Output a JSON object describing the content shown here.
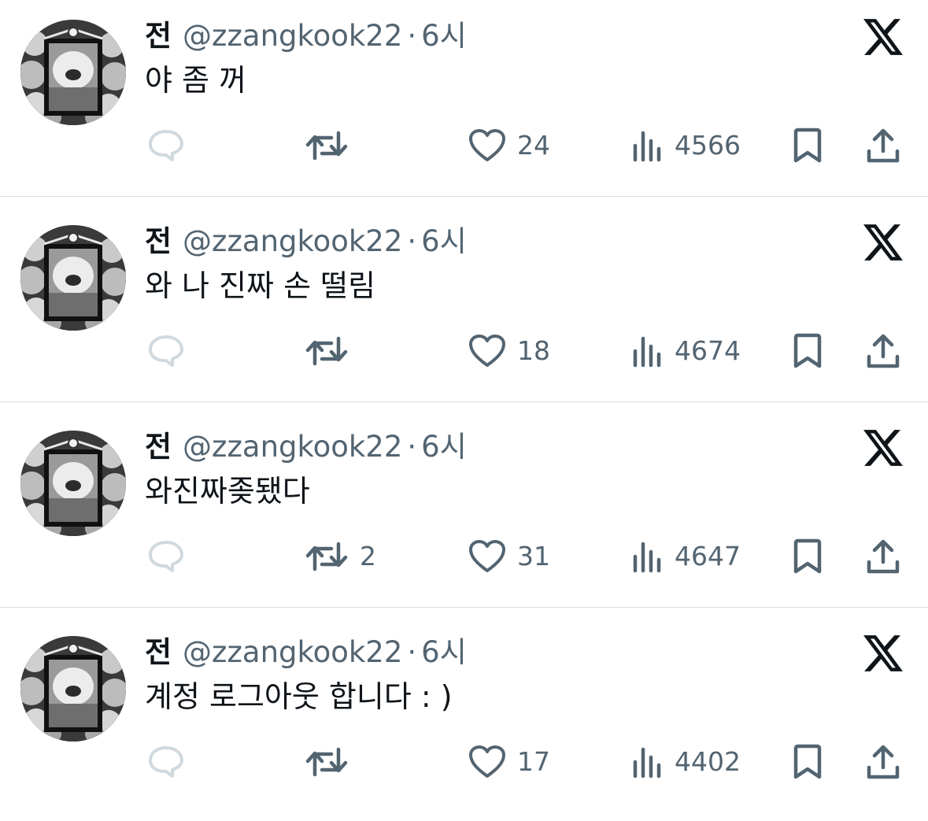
{
  "tweets": [
    {
      "name": "전",
      "handle": "@zzangkook22",
      "separator": "·",
      "time": "6시",
      "text": "야 좀 꺼",
      "retweets": "",
      "likes": "24",
      "views": "4566"
    },
    {
      "name": "전",
      "handle": "@zzangkook22",
      "separator": "·",
      "time": "6시",
      "text": "와 나 진짜 손 떨림",
      "retweets": "",
      "likes": "18",
      "views": "4674"
    },
    {
      "name": "전",
      "handle": "@zzangkook22",
      "separator": "·",
      "time": "6시",
      "text": "와진짜좆됐다",
      "retweets": "2",
      "likes": "31",
      "views": "4647"
    },
    {
      "name": "전",
      "handle": "@zzangkook22",
      "separator": "·",
      "time": "6시",
      "text": "계정 로그아웃 합니다 : )",
      "retweets": "",
      "likes": "17",
      "views": "4402"
    }
  ],
  "icons": {
    "logo": "x-logo-icon",
    "reply": "reply-icon",
    "retweet": "retweet-icon",
    "like": "heart-icon",
    "views": "views-icon",
    "bookmark": "bookmark-icon",
    "share": "share-icon"
  },
  "colors": {
    "text": "#0f1419",
    "secondary": "#536471",
    "reply_disabled": "#cfd9de",
    "divider": "#d9dde1"
  }
}
